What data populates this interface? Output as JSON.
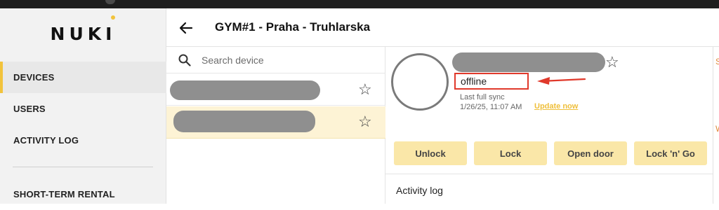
{
  "brand": {
    "logo_text": "NUKI",
    "accent": "#f2c33c"
  },
  "sidebar": {
    "items": [
      {
        "label": "DEVICES",
        "active": true
      },
      {
        "label": "USERS",
        "active": false
      },
      {
        "label": "ACTIVITY LOG",
        "active": false
      },
      {
        "label": "SHORT-TERM RENTAL",
        "active": false
      }
    ]
  },
  "header": {
    "title": "GYM#1 - Praha - Truhlarska",
    "back_icon": "arrow-left-icon"
  },
  "device_list": {
    "search": {
      "placeholder": "Search device",
      "value": "",
      "icon": "search-icon"
    },
    "devices": [
      {
        "name": "",
        "redacted": true,
        "selected": false,
        "favorite": false
      },
      {
        "name": "",
        "redacted": true,
        "selected": true,
        "favorite": false
      }
    ]
  },
  "device_detail": {
    "name": "",
    "name_redacted": true,
    "favorite": false,
    "status": "offline",
    "status_color": "#e0392b",
    "sync_label": "Last full sync",
    "sync_time": "1/26/25, 11:07 AM",
    "update_link": "Update now",
    "actions": [
      "Unlock",
      "Lock",
      "Open door",
      "Lock 'n' Go"
    ],
    "activity_log_title": "Activity log"
  },
  "right_edge_text": [
    "S",
    "W"
  ]
}
